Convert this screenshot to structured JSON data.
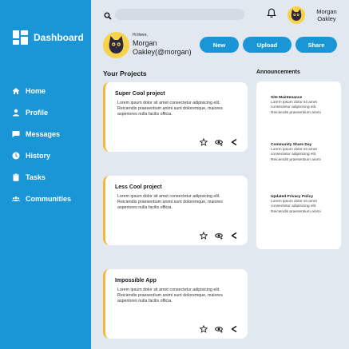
{
  "sidebar": {
    "title": "Dashboard",
    "items": [
      {
        "label": "Home",
        "icon": "home-icon"
      },
      {
        "label": "Profile",
        "icon": "user-icon"
      },
      {
        "label": "Messages",
        "icon": "message-icon"
      },
      {
        "label": "History",
        "icon": "clock-icon"
      },
      {
        "label": "Tasks",
        "icon": "clipboard-icon"
      },
      {
        "label": "Communities",
        "icon": "group-icon"
      }
    ],
    "color": "#1a96d6"
  },
  "topbar": {
    "search_placeholder": "",
    "user_first": "Morgan",
    "user_last": "Oakley"
  },
  "greeting": {
    "small": "Hi there,",
    "line1": "Morgan",
    "line2": "Oakley(@morgan)"
  },
  "actions": {
    "new_label": "New",
    "upload_label": "Upload",
    "share_label": "Share"
  },
  "projects": {
    "heading": "Your Projects",
    "items": [
      {
        "title": "Super Cool project",
        "body": "Lorem ipsum dolor sit amet consectetur adipisicing elit. Reiciendis praesentium animi sunt doloremque, maiores asperiores nulla facilis officia."
      },
      {
        "title": "Less Cool project",
        "body": "Lorem ipsum dolor sit amet consectetur adipisicing elit. Reiciendis praesentium animi sunt doloremque, maiores asperiores nulla facilis officia."
      },
      {
        "title": "Impossible App",
        "body": "Lorem ipsum dolor sit amet consectetur adipisicing elit. Reiciendis praesentium animi sunt doloremque, maiores asperiores nulla facilis officia."
      }
    ],
    "accent": "#f3b73a"
  },
  "announcements": {
    "heading": "Announcements",
    "items": [
      {
        "title": "Site Maintenance",
        "body": "Lorem ipsum dolor sit amet consectetur adipisicing elit. Reiciendis praesentium animi"
      },
      {
        "title": "Community Share Day",
        "body": "Lorem ipsum dolor sit amet consectetur adipisicing elit. Reiciendis praesentium animi"
      },
      {
        "title": "Updated Privacy Policy",
        "body": "Lorem ipsum dolor sit amet consectetur adipisicing elit. Reiciendis praesentium animi"
      }
    ]
  }
}
